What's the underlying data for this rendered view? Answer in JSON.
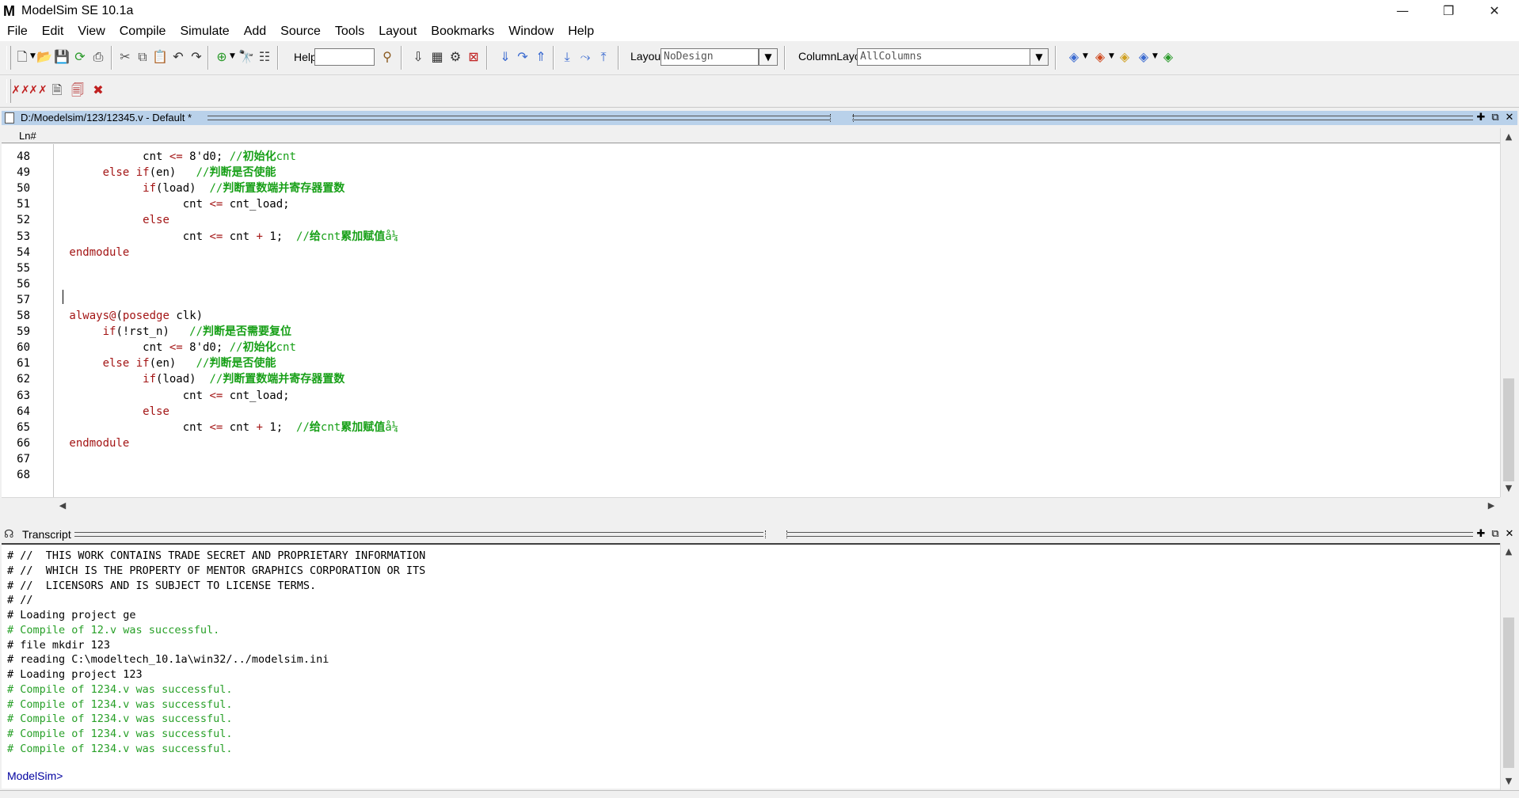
{
  "window": {
    "title": "ModelSim SE 10.1a",
    "logo": "M",
    "controls": {
      "minimize": "—",
      "restore": "❐",
      "close": "✕"
    }
  },
  "menu": [
    "File",
    "Edit",
    "View",
    "Compile",
    "Simulate",
    "Add",
    "Source",
    "Tools",
    "Layout",
    "Bookmarks",
    "Window",
    "Help"
  ],
  "toolbar": {
    "help_label": "Help",
    "help_value": "",
    "layout_label": "Layout",
    "layout_value": "NoDesign",
    "column_layout_label": "ColumnLayout",
    "column_layout_value": "AllColumns"
  },
  "source_window": {
    "title": "D:/Moedelsim/123/12345.v - Default *",
    "column_header": "Ln#",
    "lines": [
      {
        "n": "48",
        "code": [
          [
            "pl",
            "            cnt "
          ],
          [
            "op",
            "<="
          ],
          [
            "pl",
            " 8'd0; "
          ],
          [
            "cm",
            "//"
          ],
          [
            "cmb",
            "初始化"
          ],
          [
            "cm",
            "cnt"
          ]
        ]
      },
      {
        "n": "49",
        "code": [
          [
            "pl",
            "      "
          ],
          [
            "kw",
            "else if"
          ],
          [
            "pl",
            "(en)   "
          ],
          [
            "cm",
            "//"
          ],
          [
            "cmb",
            "判断是否使能"
          ]
        ]
      },
      {
        "n": "50",
        "code": [
          [
            "pl",
            "            "
          ],
          [
            "kw",
            "if"
          ],
          [
            "pl",
            "(load)  "
          ],
          [
            "cm",
            "//"
          ],
          [
            "cmb",
            "判断置数端并寄存器置数"
          ]
        ]
      },
      {
        "n": "51",
        "code": [
          [
            "pl",
            "                  cnt "
          ],
          [
            "op",
            "<="
          ],
          [
            "pl",
            " cnt_load;"
          ]
        ]
      },
      {
        "n": "52",
        "code": [
          [
            "pl",
            "            "
          ],
          [
            "kw",
            "else"
          ]
        ]
      },
      {
        "n": "53",
        "code": [
          [
            "pl",
            "                  cnt "
          ],
          [
            "op",
            "<="
          ],
          [
            "pl",
            " cnt "
          ],
          [
            "op",
            "+"
          ],
          [
            "pl",
            " 1;  "
          ],
          [
            "cm",
            "//"
          ],
          [
            "cmb",
            "给"
          ],
          [
            "cm",
            "cnt"
          ],
          [
            "cmb",
            "累加赋值"
          ],
          [
            "cm",
            "å¼"
          ]
        ]
      },
      {
        "n": "54",
        "code": [
          [
            "kw",
            " endmodule"
          ]
        ]
      },
      {
        "n": "55",
        "code": []
      },
      {
        "n": "56",
        "code": []
      },
      {
        "n": "57",
        "code": []
      },
      {
        "n": "58",
        "code": [
          [
            "kw",
            " always"
          ],
          [
            "op",
            "@"
          ],
          [
            "pl",
            "("
          ],
          [
            "kw",
            "posedge"
          ],
          [
            "pl",
            " clk)"
          ]
        ]
      },
      {
        "n": "59",
        "code": [
          [
            "pl",
            "      "
          ],
          [
            "kw",
            "if"
          ],
          [
            "pl",
            "(!rst_n)   "
          ],
          [
            "cm",
            "//"
          ],
          [
            "cmb",
            "判断是否需要复位"
          ]
        ]
      },
      {
        "n": "60",
        "code": [
          [
            "pl",
            "            cnt "
          ],
          [
            "op",
            "<="
          ],
          [
            "pl",
            " 8'd0; "
          ],
          [
            "cm",
            "//"
          ],
          [
            "cmb",
            "初始化"
          ],
          [
            "cm",
            "cnt"
          ]
        ]
      },
      {
        "n": "61",
        "code": [
          [
            "pl",
            "      "
          ],
          [
            "kw",
            "else if"
          ],
          [
            "pl",
            "(en)   "
          ],
          [
            "cm",
            "//"
          ],
          [
            "cmb",
            "判断是否使能"
          ]
        ]
      },
      {
        "n": "62",
        "code": [
          [
            "pl",
            "            "
          ],
          [
            "kw",
            "if"
          ],
          [
            "pl",
            "(load)  "
          ],
          [
            "cm",
            "//"
          ],
          [
            "cmb",
            "判断置数端并寄存器置数"
          ]
        ]
      },
      {
        "n": "63",
        "code": [
          [
            "pl",
            "                  cnt "
          ],
          [
            "op",
            "<="
          ],
          [
            "pl",
            " cnt_load;"
          ]
        ]
      },
      {
        "n": "64",
        "code": [
          [
            "pl",
            "            "
          ],
          [
            "kw",
            "else"
          ]
        ]
      },
      {
        "n": "65",
        "code": [
          [
            "pl",
            "                  cnt "
          ],
          [
            "op",
            "<="
          ],
          [
            "pl",
            " cnt "
          ],
          [
            "op",
            "+"
          ],
          [
            "pl",
            " 1;  "
          ],
          [
            "cm",
            "//"
          ],
          [
            "cmb",
            "给"
          ],
          [
            "cm",
            "cnt"
          ],
          [
            "cmb",
            "累加赋值"
          ],
          [
            "cm",
            "å¼"
          ]
        ]
      },
      {
        "n": "66",
        "code": [
          [
            "kw",
            " endmodule"
          ]
        ]
      },
      {
        "n": "67",
        "code": []
      },
      {
        "n": "68",
        "code": []
      }
    ]
  },
  "transcript": {
    "title": "Transcript",
    "lines": [
      {
        "text": "# //  THIS WORK CONTAINS TRADE SECRET AND PROPRIETARY INFORMATION",
        "ok": false
      },
      {
        "text": "# //  WHICH IS THE PROPERTY OF MENTOR GRAPHICS CORPORATION OR ITS",
        "ok": false
      },
      {
        "text": "# //  LICENSORS AND IS SUBJECT TO LICENSE TERMS.",
        "ok": false
      },
      {
        "text": "# //",
        "ok": false
      },
      {
        "text": "# Loading project ge",
        "ok": false
      },
      {
        "text": "# Compile of 12.v was successful.",
        "ok": true
      },
      {
        "text": "# file mkdir 123",
        "ok": false
      },
      {
        "text": "# reading C:\\modeltech_10.1a\\win32/../modelsim.ini",
        "ok": false
      },
      {
        "text": "# Loading project 123",
        "ok": false
      },
      {
        "text": "# Compile of 1234.v was successful.",
        "ok": true
      },
      {
        "text": "# Compile of 1234.v was successful.",
        "ok": true
      },
      {
        "text": "# Compile of 1234.v was successful.",
        "ok": true
      },
      {
        "text": "# Compile of 1234.v was successful.",
        "ok": true
      },
      {
        "text": "# Compile of 1234.v was successful.",
        "ok": true
      }
    ],
    "prompt": "ModelSim>"
  },
  "colors": {
    "header_active": "#b9d1ea",
    "keyword": "#a31515",
    "comment": "#18a018",
    "success": "#28a028",
    "prompt": "#0000a0"
  }
}
